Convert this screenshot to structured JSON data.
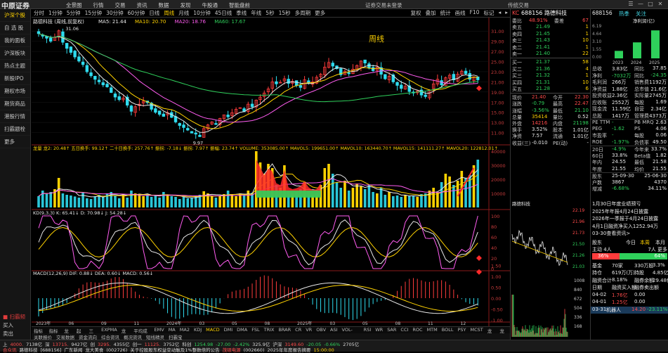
{
  "topbar": {
    "logo": "中原证券",
    "menu": [
      "全景图",
      "行情",
      "交易",
      "资讯",
      "数据",
      "发现",
      "牛股通",
      "智能盘前"
    ],
    "center_text": "证券交易未登录",
    "right_text": "传统交易",
    "win_buttons": [
      "☰",
      "—",
      "□",
      "✕"
    ]
  },
  "sidebar": {
    "items": [
      "沪深个股",
      "自 选 股",
      "我的面板",
      "沪深板块",
      "热点主题",
      "新股IPO",
      "期权市场",
      "期货商品",
      "港股行情",
      "扫霸题栓",
      "更多"
    ],
    "bottom_buttons": [
      "■ 扫霸频",
      "买入",
      "卖出"
    ]
  },
  "periodbar": {
    "periods": [
      "分时",
      "1分钟",
      "5分钟",
      "15分钟",
      "30分钟",
      "60分钟",
      "日线",
      "周线",
      "月线",
      "10分钟",
      "45日线",
      "季线",
      "年线",
      "5秒",
      "15秒",
      "多周期",
      "更多"
    ],
    "active": "周线",
    "tools": [
      "复权",
      "叠加",
      "统计",
      "画线",
      "F10",
      "标记",
      "◂",
      "▸"
    ]
  },
  "main_chart": {
    "header": "路德科技 (周线,前复权)",
    "ma": [
      {
        "label": "MA5: 21.44",
        "color": "#e8e8e8"
      },
      {
        "label": "MA10: 20.70",
        "color": "#ffd200"
      },
      {
        "label": "MA20: 18.76",
        "color": "#ff5cf0"
      },
      {
        "label": "MA60: 17.67",
        "color": "#2fd05b"
      }
    ],
    "period_label": "周线",
    "high_label": "31.06",
    "low_label": "9.97",
    "y_ticks": [
      "31.00",
      "29.00",
      "27.00",
      "25.00",
      "23.00",
      "21.00",
      "19.00",
      "17.00",
      "15.00",
      "13.00",
      "11.00"
    ],
    "y_range": [
      9.0,
      32.0
    ],
    "closes": [
      30.5,
      30.0,
      29.6,
      29.0,
      29.8,
      31.06,
      28.8,
      27.6,
      26.8,
      25.9,
      25.1,
      24.4,
      23.0,
      22.2,
      21.5,
      21.0,
      20.4,
      20.0,
      18.9,
      18.0,
      17.5,
      17.8,
      16.4,
      15.2,
      16.1,
      16.6,
      17.2,
      16.9,
      15.6,
      15.0,
      14.6,
      14.2,
      14.9,
      14.0,
      13.1,
      12.4,
      12.0,
      11.5,
      10.9,
      10.7,
      10.2,
      11.8,
      12.5,
      13.1,
      12.6,
      13.8,
      14.5,
      14.1,
      14.9,
      15.6,
      15.9,
      15.1,
      16.6,
      16.1,
      17.4,
      18.0,
      18.8,
      19.6,
      21.0,
      20.6,
      20.9,
      21.6,
      20.7,
      21.1,
      20.3,
      19.9,
      21.4,
      20.8,
      21.0,
      21.9,
      22.5,
      23.9,
      24.8,
      24.1,
      23.6,
      22.4,
      23.1,
      22.6,
      23.5,
      24.2,
      25.1,
      24.7,
      23.7,
      23.2,
      23.9,
      22.5,
      21.6,
      22.1,
      21.0,
      20.3,
      19.7,
      20.1,
      19.1,
      18.8,
      19.2,
      18.4,
      18.1,
      19.4,
      20.6,
      21.5,
      20.4,
      21.8,
      22.3,
      21.4,
      22.5,
      23.1,
      22.6,
      21.5,
      22.0,
      21.4
    ]
  },
  "volume": {
    "header": "龙量 龙2: 20.48↑ 五日换手: 99.12↑ 二十日换手: 257.76↑ 振拐: -7.18↓ 振拐: 7.97↑ 振幅: 23.74↑ VOLUME: 353085.00↑ MAVOL5: 199651.00↑ MAVOL10: 163440.70↑ MAVOL15: 141111.27↑ MAVOL20: 122812.01↑",
    "y_ticks": [
      "40000",
      "30000",
      "20000",
      "10000"
    ],
    "y_max": 40000,
    "values": [
      8000,
      12000,
      9500,
      11000,
      13000,
      21000,
      10000,
      9000,
      8500,
      7800,
      7000,
      10500,
      6500,
      6000,
      8000,
      9000,
      7500,
      10000,
      11000,
      8500,
      6500,
      9500,
      7000,
      12000,
      10000,
      9000,
      8000,
      9500,
      7500,
      8500,
      7000,
      11000,
      9000,
      8000,
      7500,
      6000,
      7500,
      6500,
      7000,
      8000,
      9000,
      11500,
      10000,
      8000,
      7000,
      8500,
      9500,
      12000,
      9000,
      8000,
      10000,
      8500,
      12000,
      10500,
      40000,
      32000,
      24000,
      31000,
      28000,
      16000,
      14000,
      30000,
      12000,
      10000,
      11000,
      13000,
      18000,
      12000,
      9000,
      10000,
      16000,
      28000,
      31000,
      24000,
      18000,
      14000,
      19000,
      12000,
      14000,
      17000,
      15000,
      13000,
      16000,
      11000,
      10000,
      14000,
      9000,
      11000,
      8000,
      8500,
      7500,
      9000,
      8000,
      8500,
      7500,
      9500,
      10000,
      12000,
      14000,
      10500,
      18000,
      24000,
      22000,
      16000,
      19000,
      26000,
      21000,
      23000,
      30000,
      34000
    ]
  },
  "kdj": {
    "header": "KD(9,3,3) K: 65.41↓ D: 70.98↓ J: 54.28↓",
    "y_ticks": [
      "100",
      "80",
      "60",
      "40",
      "20",
      "0"
    ]
  },
  "macd": {
    "header": "MACD(12,26,9) DIF: 0.88↓ DEA: 0.60↓ MACD: 0.56↓",
    "y_ticks": [
      "1.50",
      "1.00",
      "0.50",
      "0.00",
      "-0.50",
      "-1.00"
    ]
  },
  "x_labels": [
    "2023年",
    "06",
    "09",
    "11",
    "2024年",
    "03",
    "05",
    "08",
    "2025年",
    "03",
    "05",
    "08",
    "11",
    "12"
  ],
  "indicator_tabs": [
    "指标A",
    "指标B",
    "龙量",
    "起爆",
    "三线",
    "EXPMA",
    "龙量",
    "平均成本",
    "EMV",
    "MA",
    "MA2",
    "KDJ",
    "MACD",
    "DMI",
    "DMA",
    "FSL",
    "TRIX",
    "BRAR",
    "CR",
    "VR",
    "OBV",
    "ASI",
    "VOL-TDX",
    "RSI",
    "WR",
    "SAR",
    "CCI",
    "ROC",
    "MTM",
    "BOLL",
    "PSY",
    "MCST",
    "龙线",
    "龙线"
  ],
  "active_indicator": "MACD",
  "sub_tabs": [
    "关联报价",
    "交易数据",
    "资金流向",
    "综合资讯",
    "概况资讯",
    "短线精灵",
    "扫霸宝"
  ],
  "orderbook": {
    "code": "KC",
    "stock_code": "688156",
    "name": "路德科技",
    "weibi": {
      "label": "委比",
      "value": "48.91%",
      "mid": "委差",
      "right": "67"
    },
    "asks": [
      {
        "label": "卖五",
        "price": "21.49",
        "vol": "1"
      },
      {
        "label": "卖四",
        "price": "21.45",
        "vol": "1"
      },
      {
        "label": "卖三",
        "price": "21.43",
        "vol": "10"
      },
      {
        "label": "卖二",
        "price": "21.41",
        "vol": "1"
      },
      {
        "label": "卖一",
        "price": "21.40",
        "vol": "22"
      }
    ],
    "bids": [
      {
        "label": "买一",
        "price": "21.37",
        "vol": "58"
      },
      {
        "label": "买二",
        "price": "21.36",
        "vol": "4"
      },
      {
        "label": "买三",
        "price": "21.32",
        "vol": "1"
      },
      {
        "label": "买四",
        "price": "21.31",
        "vol": "10"
      },
      {
        "label": "买五",
        "price": "21.28",
        "vol": "6"
      }
    ],
    "quote": [
      {
        "l": "现价",
        "v": "21.40",
        "l2": "今开",
        "v2": "22.30",
        "c1": "red",
        "c2": "red"
      },
      {
        "l": "涨跌",
        "v": "-0.79",
        "l2": "最高",
        "v2": "22.47",
        "c1": "green",
        "c2": "red"
      },
      {
        "l": "涨幅",
        "v": "-3.56%",
        "l2": "最低",
        "v2": "21.10",
        "c1": "green",
        "c2": "green"
      },
      {
        "l": "总量",
        "v": "35414",
        "l2": "量比",
        "v2": "0.52",
        "c1": "yellow",
        "c2": "white"
      },
      {
        "l": "外盘",
        "v": "14216",
        "l2": "内盘",
        "v2": "21198",
        "c1": "red",
        "c2": "green"
      },
      {
        "l": "换手",
        "v": "3.52%",
        "l2": "股本",
        "v2": "1.01亿",
        "c1": "white",
        "c2": "white"
      },
      {
        "l": "净资",
        "v": "7.57",
        "l2": "流通",
        "v2": "1.01亿",
        "c1": "white",
        "c2": "white"
      },
      {
        "l": "收益(三)",
        "v": "-0.010",
        "l2": "PE(动)",
        "v2": "-",
        "c1": "white",
        "c2": "white"
      }
    ]
  },
  "fundamentals": {
    "code": "688156",
    "tags": [
      "热季",
      "关注"
    ],
    "mini_chart": {
      "title": "净利润(亿)",
      "years": [
        "2023",
        "2024",
        "2025"
      ],
      "ticks": [
        "6.19",
        "4.64",
        "3.10",
        "1.55",
        "0.00"
      ],
      "values": [
        1.5,
        3.2,
        5.6
      ]
    },
    "rows": [
      {
        "l": "总收",
        "v": "3.83亿",
        "l2": "同比",
        "v2": "37.85"
      },
      {
        "l": "净利",
        "v": "-7032万",
        "l2": "同比",
        "v2": "-24.35"
      },
      {
        "l": "毛利润",
        "v": "266万",
        "l2": "销售费",
        "v2": "1192万"
      },
      {
        "l": "净资益",
        "v": "1.88亿",
        "l2": "总市值",
        "v2": "21.6亿"
      },
      {
        "l": "投资收益",
        "v": "2.36亿",
        "l2": "实际量",
        "v2": "2745万"
      },
      {
        "l": "应收账",
        "v": "2552万",
        "l2": "每股",
        "v2": "1.69"
      },
      {
        "l": "现金流",
        "v": "11.59亿",
        "l2": "自营",
        "v2": "2.34亿"
      },
      {
        "l": "总股",
        "v": "1417万",
        "l2": "管理费",
        "v2": "4373万"
      },
      {
        "l": "PE TTM",
        "v": "-",
        "l2": "PB MRQ",
        "v2": "2.63"
      },
      {
        "l": "PEG",
        "v": "-1.62",
        "l2": "PS",
        "v2": "4.06"
      },
      {
        "l": "市盈率",
        "v": "-",
        "l2": "每股",
        "v2": "0.06"
      },
      {
        "l": "ROE",
        "v": "-1.97%",
        "l2": "负债率",
        "v2": "49.50"
      },
      {
        "l": "20日",
        "v": "-4.9%",
        "l2": "今年来",
        "v2": "33.7%"
      },
      {
        "l": "60日",
        "v": "33.8%",
        "l2": "Beta值",
        "v2": "1.82"
      },
      {
        "l": "年内",
        "v": "24.55",
        "l2": "最低",
        "v2": "21.58"
      },
      {
        "l": "年度",
        "v": "21.55",
        "l2": "均价",
        "v2": "21.55"
      },
      {
        "l": "股东",
        "v": "25-09-30",
        "l2": "",
        "v2": "25-06-30"
      },
      {
        "l": "户数",
        "v": "3867",
        "l2": "",
        "v2": "4370"
      },
      {
        "l": "增减",
        "v": "-6.68%",
        "l2": "",
        "v2": "34.11%"
      }
    ]
  },
  "news": {
    "lines": [
      "1月30日年度业绩预亏",
      "2025年年报4月24日披露",
      "2026年一季报于4月24日披露",
      "4月1日融资净买入1252.94万",
      "03-30查看资讯>"
    ],
    "flow_title": "股东",
    "flow_today": "今日",
    "flow_week": "本周",
    "flow_month": "本月",
    "flow_in_label": "主动 4人",
    "flow_out_label": "7人 更多",
    "in_pct": "36%",
    "out_pct": "64%",
    "fund_rows": [
      {
        "l": "基金",
        "v": "70家",
        "v2": "330万股",
        "v3": "3.3%"
      },
      {
        "l": "持仓",
        "v": "619万(万)",
        "l2": "持股",
        "v2": "4.85亿(万)"
      },
      {
        "l": "融资合计",
        "v": "8.18%",
        "l2": "融券余额",
        "v2": "29.48亿"
      },
      {
        "l": "日期",
        "v": "融资买入额",
        "v2": "融券卖出额"
      },
      {
        "l": "04-02",
        "v": "1.76亿",
        "v2": "0.00"
      },
      {
        "l": "04-01",
        "v": "1.25亿",
        "v2": "0.00"
      }
    ],
    "bottom_row": {
      "l": "03-31",
      "v": "机器人",
      "v2": "14.20",
      "v3": "-23.11%"
    }
  },
  "tick_chart": {
    "label": "路德科技",
    "y_ticks": [
      "22.19",
      "21.96",
      "21.73",
      "21.50",
      "21.26",
      "21.03"
    ],
    "vol_ticks": [
      "1008",
      "840",
      "672",
      "504",
      "336",
      "168"
    ]
  },
  "statusbar": {
    "row1": [
      {
        "t": "上",
        "c": "white"
      },
      {
        "t": "4000.",
        "c": "red"
      },
      {
        "t": "7138亿",
        "c": "white"
      },
      {
        "t": "深",
        "c": "white"
      },
      {
        "t": "13715.",
        "c": "red"
      },
      {
        "t": "9427亿",
        "c": "white"
      },
      {
        "t": "创",
        "c": "white"
      },
      {
        "t": "3295.",
        "c": "red"
      },
      {
        "t": "4355亿",
        "c": "white"
      },
      {
        "t": "创一",
        "c": "white"
      },
      {
        "t": "11125.",
        "c": "red"
      },
      {
        "t": "3752亿",
        "c": "white"
      },
      {
        "t": "科创",
        "c": "white"
      },
      {
        "t": "1254.98",
        "c": "green"
      },
      {
        "t": "-27.00",
        "c": "green"
      },
      {
        "t": "-2.42%",
        "c": "green"
      },
      {
        "t": "325.9亿",
        "c": "white"
      },
      {
        "t": "沪深",
        "c": "white"
      },
      {
        "t": "3149.60",
        "c": "red"
      },
      {
        "t": "-20.05",
        "c": "green"
      },
      {
        "t": "-0.66%",
        "c": "green"
      },
      {
        "t": "2705亿",
        "c": "white"
      }
    ],
    "row2": [
      {
        "t": "合众讯",
        "c": "red"
      },
      {
        "t": "路德科技",
        "c": "white"
      },
      {
        "t": "[688156]",
        "c": "white"
      },
      {
        "t": "广东新闻",
        "c": "white"
      },
      {
        "t": "龙大美食",
        "c": "white"
      },
      {
        "t": "(002726)",
        "c": "white"
      },
      {
        "t": "关于控股股东权益变动触及1%整数倍的公告",
        "c": "white"
      },
      {
        "t": "茂硕电源",
        "c": "red"
      },
      {
        "t": "(002660)",
        "c": "white"
      },
      {
        "t": "2025年年度报告摘要",
        "c": "white"
      },
      {
        "t": "15:00:00",
        "c": "yellow"
      }
    ]
  }
}
